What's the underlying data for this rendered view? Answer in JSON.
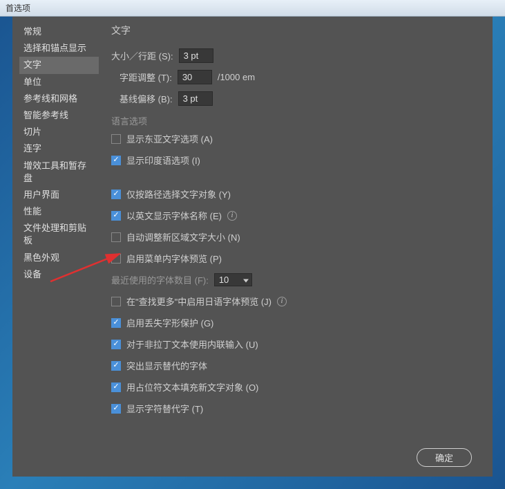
{
  "titlebar": "首选项",
  "sidebar": {
    "items": [
      "常规",
      "选择和锚点显示",
      "文字",
      "单位",
      "参考线和网格",
      "智能参考线",
      "切片",
      "连字",
      "增效工具和暂存盘",
      "用户界面",
      "性能",
      "文件处理和剪贴板",
      "黑色外观",
      "设备"
    ],
    "activeIndex": 2
  },
  "main": {
    "title": "文字",
    "sizeRow": {
      "label": "大小／行距 (S):",
      "value": "3 pt"
    },
    "trackingRow": {
      "label": "字距调整 (T):",
      "value": "30",
      "unit": "/1000 em"
    },
    "baselineRow": {
      "label": "基线偏移 (B):",
      "value": "3 pt"
    },
    "langGroup": "语言选项",
    "cb_eastAsian": {
      "label": "显示东亚文字选项 (A)",
      "checked": false
    },
    "cb_indic": {
      "label": "显示印度语选项 (I)",
      "checked": true
    },
    "cb_pathType": {
      "label": "仅按路径选择文字对象 (Y)",
      "checked": true
    },
    "cb_englishFont": {
      "label": "以英文显示字体名称 (E)",
      "checked": true
    },
    "cb_autoResize": {
      "label": "自动调整新区域文字大小 (N)",
      "checked": false
    },
    "cb_menuPreview": {
      "label": "启用菜单内字体预览 (P)",
      "checked": false
    },
    "recentFontsRow": {
      "label": "最近使用的字体数目 (F):",
      "value": "10"
    },
    "cb_jpPreview": {
      "label": "在\"查找更多\"中启用日语字体预览 (J)",
      "checked": false
    },
    "cb_glyphProtect": {
      "label": "启用丢失字形保护 (G)",
      "checked": true
    },
    "cb_inlineInput": {
      "label": "对于非拉丁文本使用内联输入 (U)",
      "checked": true
    },
    "cb_highlightAlt": {
      "label": "突出显示替代的字体",
      "checked": true
    },
    "cb_placeholderFill": {
      "label": "用占位符文本填充新文字对象 (O)",
      "checked": true
    },
    "cb_showAltGlyphs": {
      "label": "显示字符替代字 (T)",
      "checked": true
    }
  },
  "buttons": {
    "ok": "确定"
  }
}
